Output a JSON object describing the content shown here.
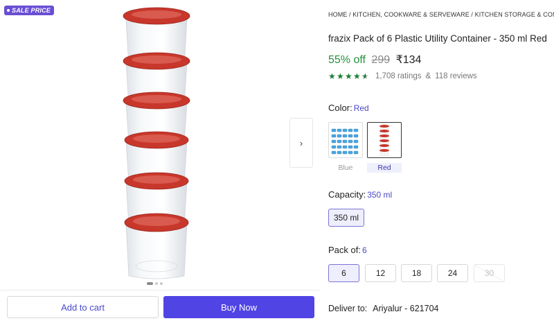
{
  "gallery": {
    "sale_badge": "SALE PRICE",
    "next_arrow": "›",
    "dots_count": 3,
    "active_dot": 0
  },
  "actions": {
    "add_to_cart": "Add to cart",
    "buy_now": "Buy Now"
  },
  "breadcrumb": "HOME / KITCHEN, COOKWARE & SERVEWARE / KITCHEN STORAGE & CONTAINERS /",
  "product": {
    "title": "frazix Pack of 6 Plastic Utility Container  - 350 ml Red",
    "discount": "55% off",
    "mrp": "299",
    "price": "₹134",
    "rating_stars": 4.5,
    "ratings": "1,708 ratings",
    "reviews": "118 reviews",
    "reviews_prefix": "&"
  },
  "color": {
    "label": "Color:",
    "selected": "Red",
    "options": [
      {
        "name": "Blue",
        "available": true
      },
      {
        "name": "Red",
        "available": true
      }
    ]
  },
  "capacity": {
    "label": "Capacity:",
    "selected": "350 ml",
    "options": [
      "350 ml"
    ]
  },
  "pack": {
    "label": "Pack of:",
    "selected": "6",
    "options": [
      "6",
      "12",
      "18",
      "24",
      "30"
    ],
    "unavailable": [
      "30"
    ]
  },
  "delivery": {
    "label": "Deliver to:",
    "location": "Ariyalur - 621704"
  },
  "colors": {
    "accent": "#5144e5",
    "discount_green": "#23913a",
    "star_green": "#1c7d35",
    "lid_red": "#c8372b",
    "badge_purple": "#6a4fd4"
  }
}
